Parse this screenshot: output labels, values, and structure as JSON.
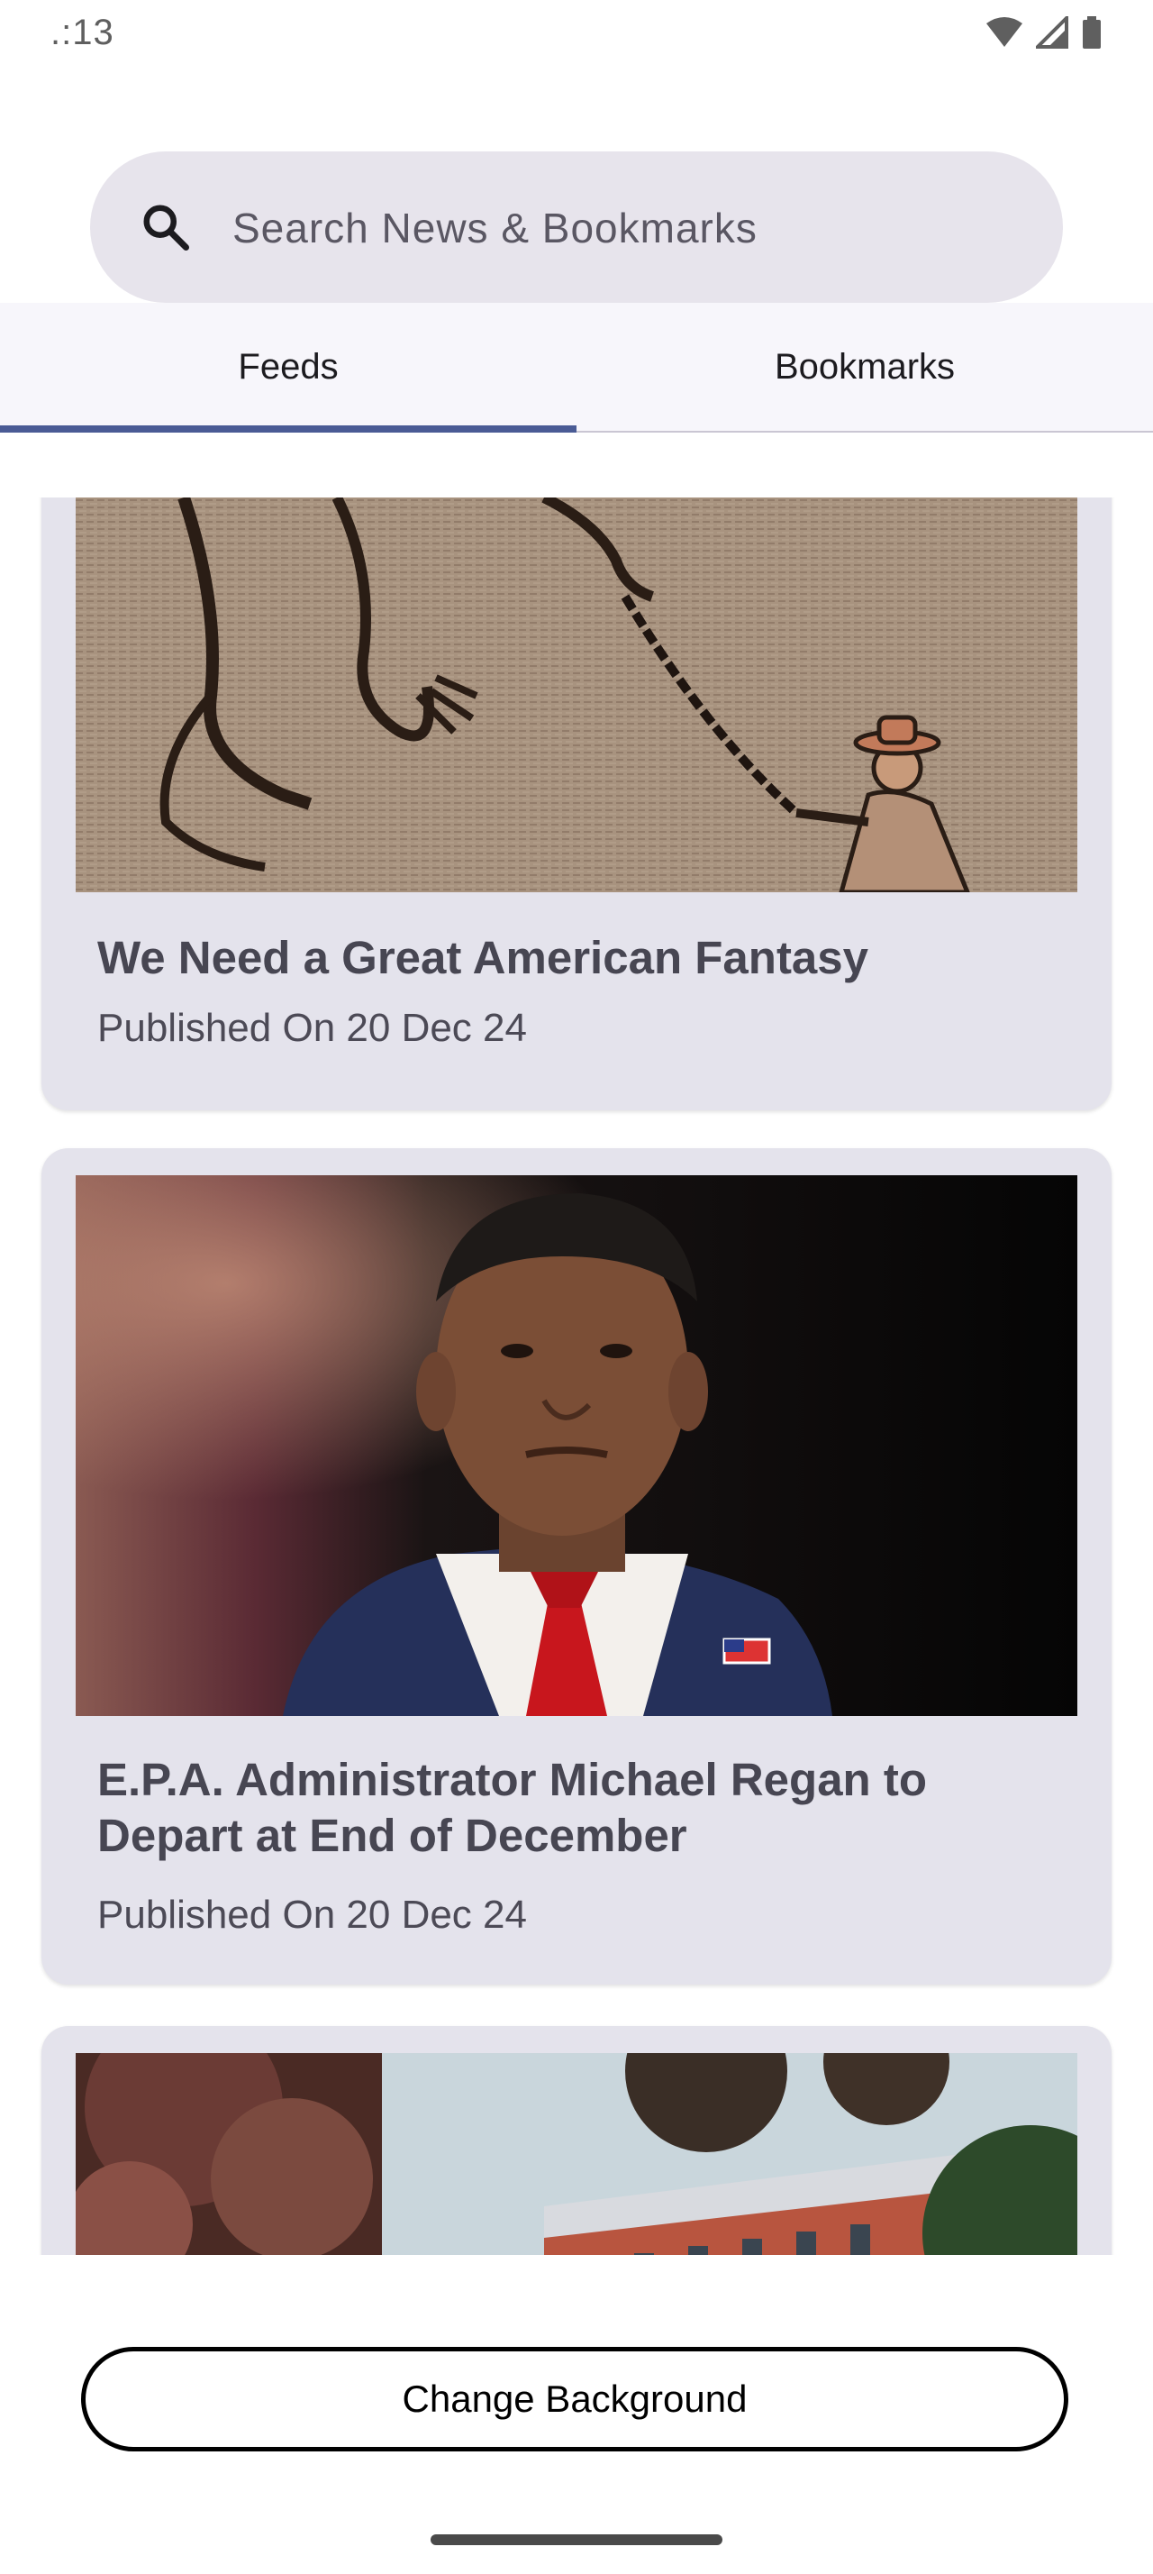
{
  "status_bar": {
    "time": ".:13"
  },
  "search": {
    "placeholder": "Search News & Bookmarks",
    "icon": "search-icon"
  },
  "tabs": [
    {
      "label": "Feeds",
      "active": true
    },
    {
      "label": "Bookmarks",
      "active": false
    }
  ],
  "feed": [
    {
      "title": "We Need a Great American Fantasy",
      "published": "Published On 20 Dec 24",
      "image": "illustration-dragon-chain-cowboy"
    },
    {
      "title": "E.P.A. Administrator Michael Regan to Depart at End of December",
      "published": "Published On 20 Dec 24",
      "image": "portrait-man-suit-red-tie"
    },
    {
      "title": "",
      "published": "",
      "image": "trees-brick-building"
    }
  ],
  "footer": {
    "change_background_label": "Change Background"
  },
  "colors": {
    "search_bg": "#e7e4ec",
    "tab_indicator": "#4a5b95",
    "card_bg": "#e4e3ec"
  }
}
